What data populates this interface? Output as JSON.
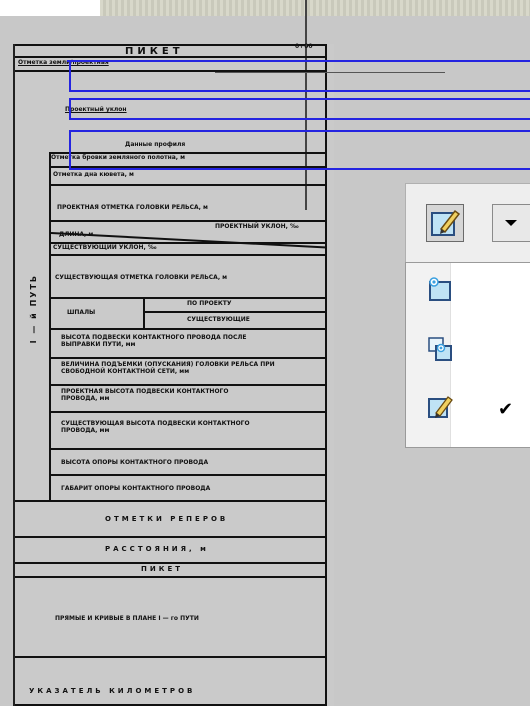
{
  "profile": {
    "picket_header": "ПИКЕТ",
    "picket_number": "0+00",
    "row_design_speed": "Отметка земли/проектная",
    "row_design_grade": "Проектный уклон",
    "row_data_header": "Данные профиля",
    "row_base_level": "Отметка бровки земляного полотна, м",
    "row_bottom": "Отметка дна кювета, м",
    "row_rail_head": "ПРОЕКТНАЯ ОТМЕТКА ГОЛОВКИ РЕЛЬСА, м",
    "row_distance": "ДЛИНА, м",
    "row_grade_label": "ПРОЕКТНЫЙ УКЛОН, ‰",
    "row_existing": "СУЩЕСТВУЮЩИЙ УКЛОН, ‰",
    "row_existing_rail": "СУЩЕСТВУЮЩАЯ ОТМЕТКА ГОЛОВКИ РЕЛЬСА, м",
    "row_sleepers": "ШПАЛЫ",
    "row_sleepers_design": "ПО ПРОЕКТУ",
    "row_sleepers_existing": "СУЩЕСТВУЮЩИЕ",
    "row_wire_height": "ВЫСОТА ПОДВЕСКИ КОНТАКТНОГО ПРОВОДА ПОСЛЕ ВЫПРАВКИ ПУТИ, мм",
    "row_lift": "ВЕЛИЧИНА ПОДЪЕМКИ (ОПУСКАНИЯ) ГОЛОВКИ РЕЛЬСА ПРИ СВОБОДНОЙ КОНТАКТНОЙ СЕТИ, мм",
    "row_wire_design": "ПРОЕКТНАЯ ВЫСОТА ПОДВЕСКИ КОНТАКТНОГО ПРОВОДА, мм",
    "row_wire_existing": "СУЩЕСТВУЮЩАЯ ВЫСОТА ПОДВЕСКИ КОНТАКТНОГО ПРОВОДА, мм",
    "row_support_height": "ВЫСОТА ОПОРЫ КОНТАКТНОГО ПРОВОДА",
    "row_support_gauge": "ГАБАРИТ ОПОРЫ КОНТАКТНОГО ПРОВОДА",
    "row_benchmarks": "ОТМЕТКИ РЕПЕРОВ",
    "row_distances": "РАССТОЯНИЯ, м",
    "row_picket": "ПИКЕТ",
    "row_curves": "ПРЯМЫЕ И КРИВЫЕ В ПЛАНЕ I — го ПУТИ",
    "row_km": "УКАЗАТЕЛЬ КИЛОМЕТРОВ",
    "side_label": "I — й   ПУТЬ"
  },
  "toolbar": {
    "pencil_icon": "pencil-edit-icon",
    "dropdown_arrow_icon": "chevron-down-icon"
  },
  "menu": {
    "items": [
      {
        "icon": "new-sheet-sparkle-icon",
        "checked": false
      },
      {
        "icon": "copy-sheet-sparkle-icon",
        "checked": false
      },
      {
        "icon": "pencil-edit-icon",
        "checked": true
      }
    ],
    "check_glyph": "✔"
  },
  "colors": {
    "accent_blue": "#2424e0",
    "background": "#c8c8c8"
  }
}
